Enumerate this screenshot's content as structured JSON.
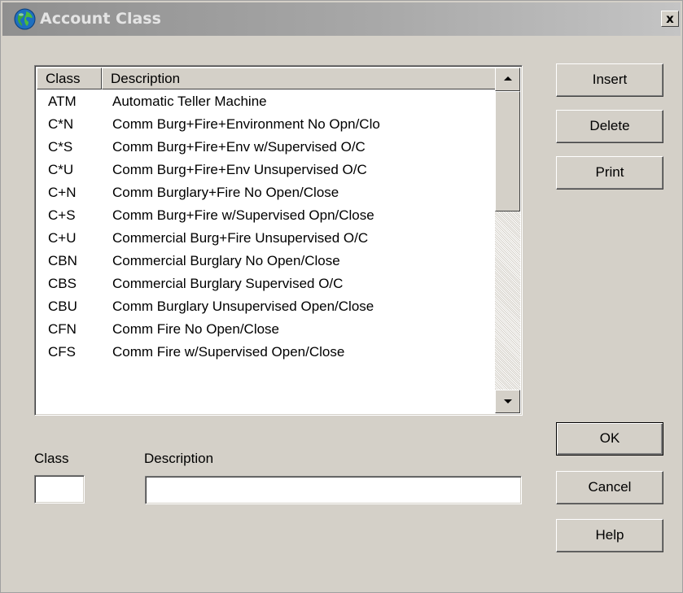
{
  "window": {
    "title": "Account Class",
    "close_label": "x"
  },
  "list": {
    "columns": [
      "Class",
      "Description"
    ],
    "rows": [
      {
        "class": "ATM",
        "description": "Automatic Teller Machine"
      },
      {
        "class": "C*N",
        "description": "Comm Burg+Fire+Environment No Opn/Clo"
      },
      {
        "class": "C*S",
        "description": "Comm Burg+Fire+Env w/Supervised O/C"
      },
      {
        "class": "C*U",
        "description": "Comm Burg+Fire+Env Unsupervised O/C"
      },
      {
        "class": "C+N",
        "description": "Comm Burglary+Fire No Open/Close"
      },
      {
        "class": "C+S",
        "description": "Comm Burg+Fire w/Supervised Opn/Close"
      },
      {
        "class": "C+U",
        "description": "Commercial Burg+Fire Unsupervised O/C"
      },
      {
        "class": "CBN",
        "description": "Commercial Burglary No Open/Close"
      },
      {
        "class": "CBS",
        "description": "Commercial Burglary Supervised O/C"
      },
      {
        "class": "CBU",
        "description": "Comm Burglary Unsupervised Open/Close"
      },
      {
        "class": "CFN",
        "description": "Comm Fire No Open/Close"
      },
      {
        "class": "CFS",
        "description": "Comm Fire w/Supervised Open/Close"
      }
    ]
  },
  "buttons": {
    "insert": "Insert",
    "delete": "Delete",
    "print": "Print",
    "ok": "OK",
    "cancel": "Cancel",
    "help": "Help"
  },
  "form": {
    "class_label": "Class",
    "class_value": "",
    "description_label": "Description",
    "description_value": ""
  },
  "icons": {
    "app": "globe-icon",
    "close": "close-icon",
    "scroll_up": "arrow-up-icon",
    "scroll_down": "arrow-down-icon"
  },
  "colors": {
    "dialog_face": "#d4d0c8",
    "title_gradient_start": "#8f8f8f",
    "title_gradient_end": "#c4c4c4",
    "title_text": "#e4e4e4",
    "list_background": "#ffffff"
  }
}
